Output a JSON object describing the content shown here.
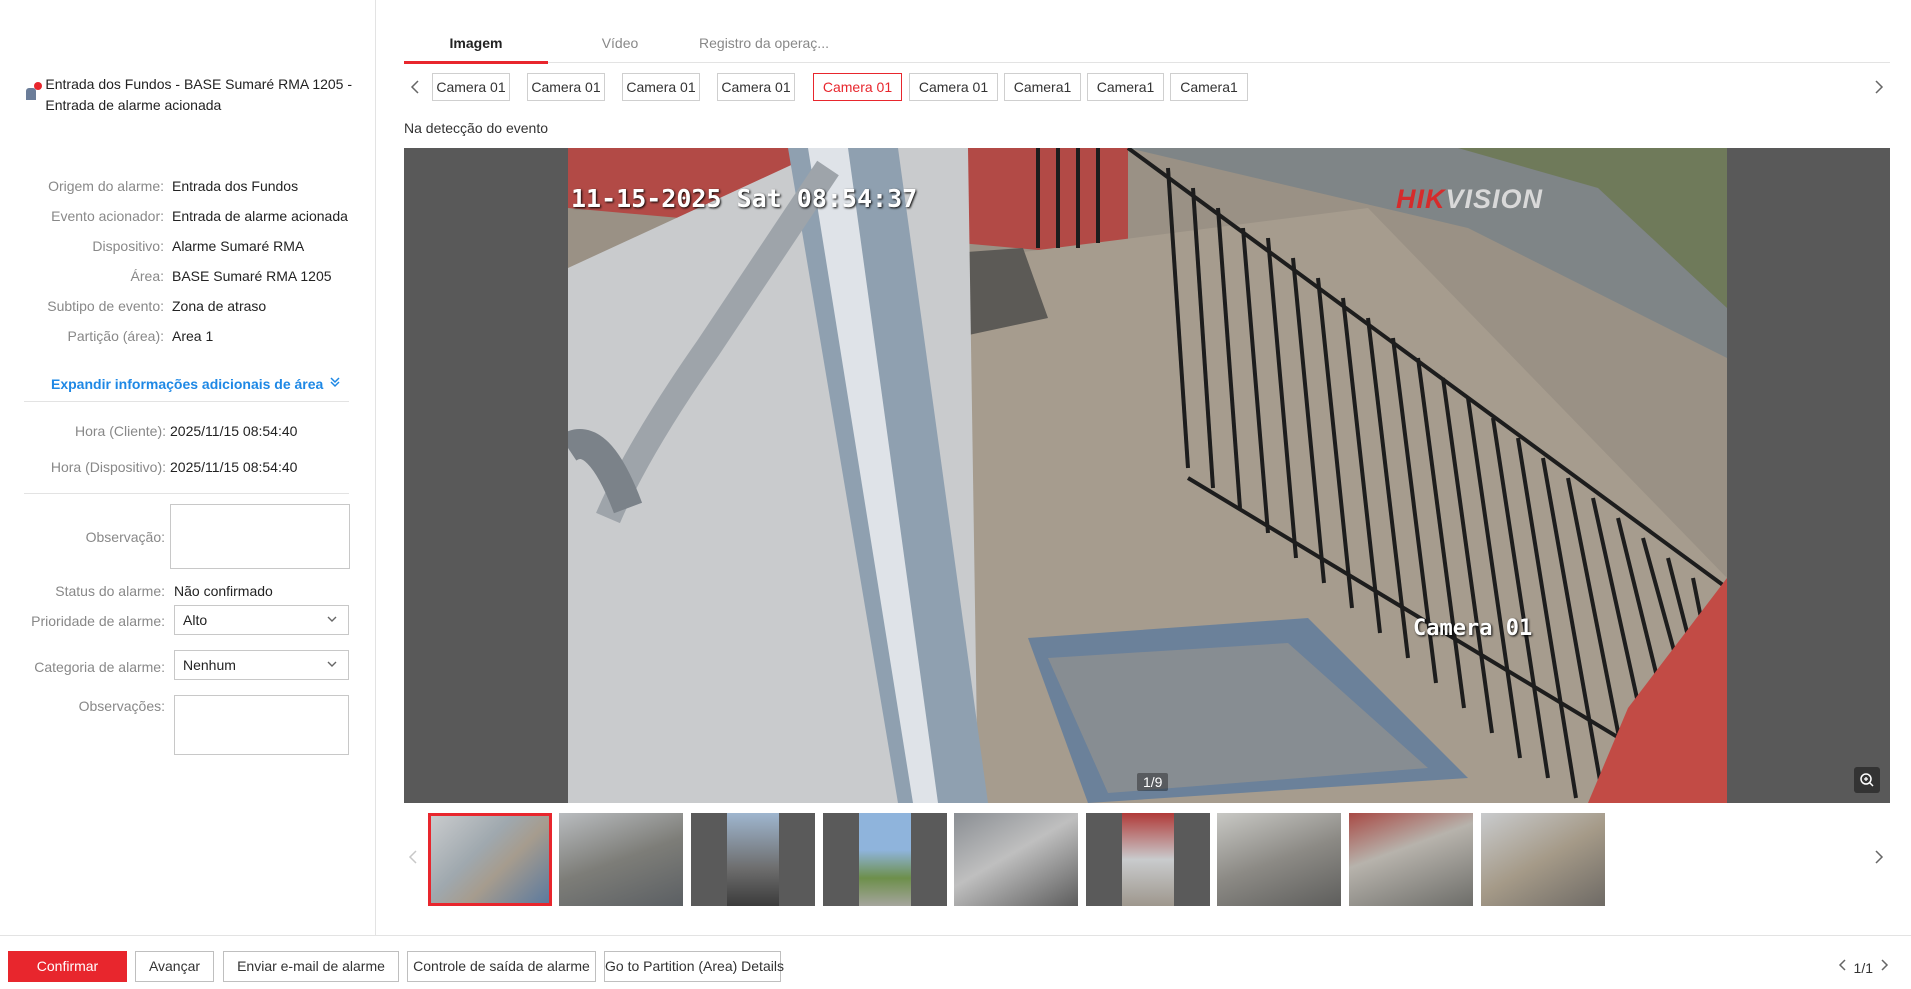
{
  "alarm": {
    "title": "Entrada dos Fundos - BASE Sumaré RMA 1205 - Entrada de alarme acionada",
    "details": [
      {
        "label": "Origem do alarme:",
        "value": "Entrada dos Fundos"
      },
      {
        "label": "Evento acionador:",
        "value": "Entrada de alarme acionada"
      },
      {
        "label": "Dispositivo:",
        "value": "Alarme Sumaré RMA"
      },
      {
        "label": "Área:",
        "value": "BASE Sumaré RMA 1205"
      },
      {
        "label": "Subtipo de evento:",
        "value": "Zona de atraso"
      },
      {
        "label": "Partição (área):",
        "value": "Area 1"
      }
    ],
    "expand_link": "Expandir informações adicionais de área",
    "client_time_label": "Hora (Cliente):",
    "client_time": "2025/11/15 08:54:40",
    "device_time_label": "Hora (Dispositivo):",
    "device_time": "2025/11/15 08:54:40",
    "observation_label": "Observação:",
    "status_label": "Status do alarme:",
    "status_value": "Não confirmado",
    "priority_label": "Prioridade de alarme:",
    "priority_value": "Alto",
    "category_label": "Categoria de alarme:",
    "category_value": "Nenhum",
    "remarks_label": "Observações:"
  },
  "tabs": [
    {
      "label": "Imagem",
      "active": true
    },
    {
      "label": "Vídeo",
      "active": false
    },
    {
      "label": "Registro da operaç...",
      "active": false
    }
  ],
  "cameras": [
    "Camera 01",
    "Camera 01",
    "Camera 01",
    "Camera 01",
    "Camera 01",
    "Camera 01",
    "Camera1",
    "Camera1",
    "Camera1"
  ],
  "active_camera_index": 4,
  "event_caption": "Na detecção do evento",
  "snapshot": {
    "timestamp_overlay": "11-15-2025 Sat 08:54:37",
    "brand_hik": "HIK",
    "brand_vision": "VISION",
    "camera_overlay": "Camera 01",
    "counter": "1/9"
  },
  "thumbnails_count": 9,
  "actions": {
    "confirm": "Confirmar",
    "next": "Avançar",
    "email": "Enviar e-mail de alarme",
    "output": "Controle de saída de alarme",
    "partition": "Go to Partition (Area) Details"
  },
  "pager": {
    "text": "1/1"
  },
  "colors": {
    "accent": "#e8262d",
    "link": "#1e88e5"
  }
}
